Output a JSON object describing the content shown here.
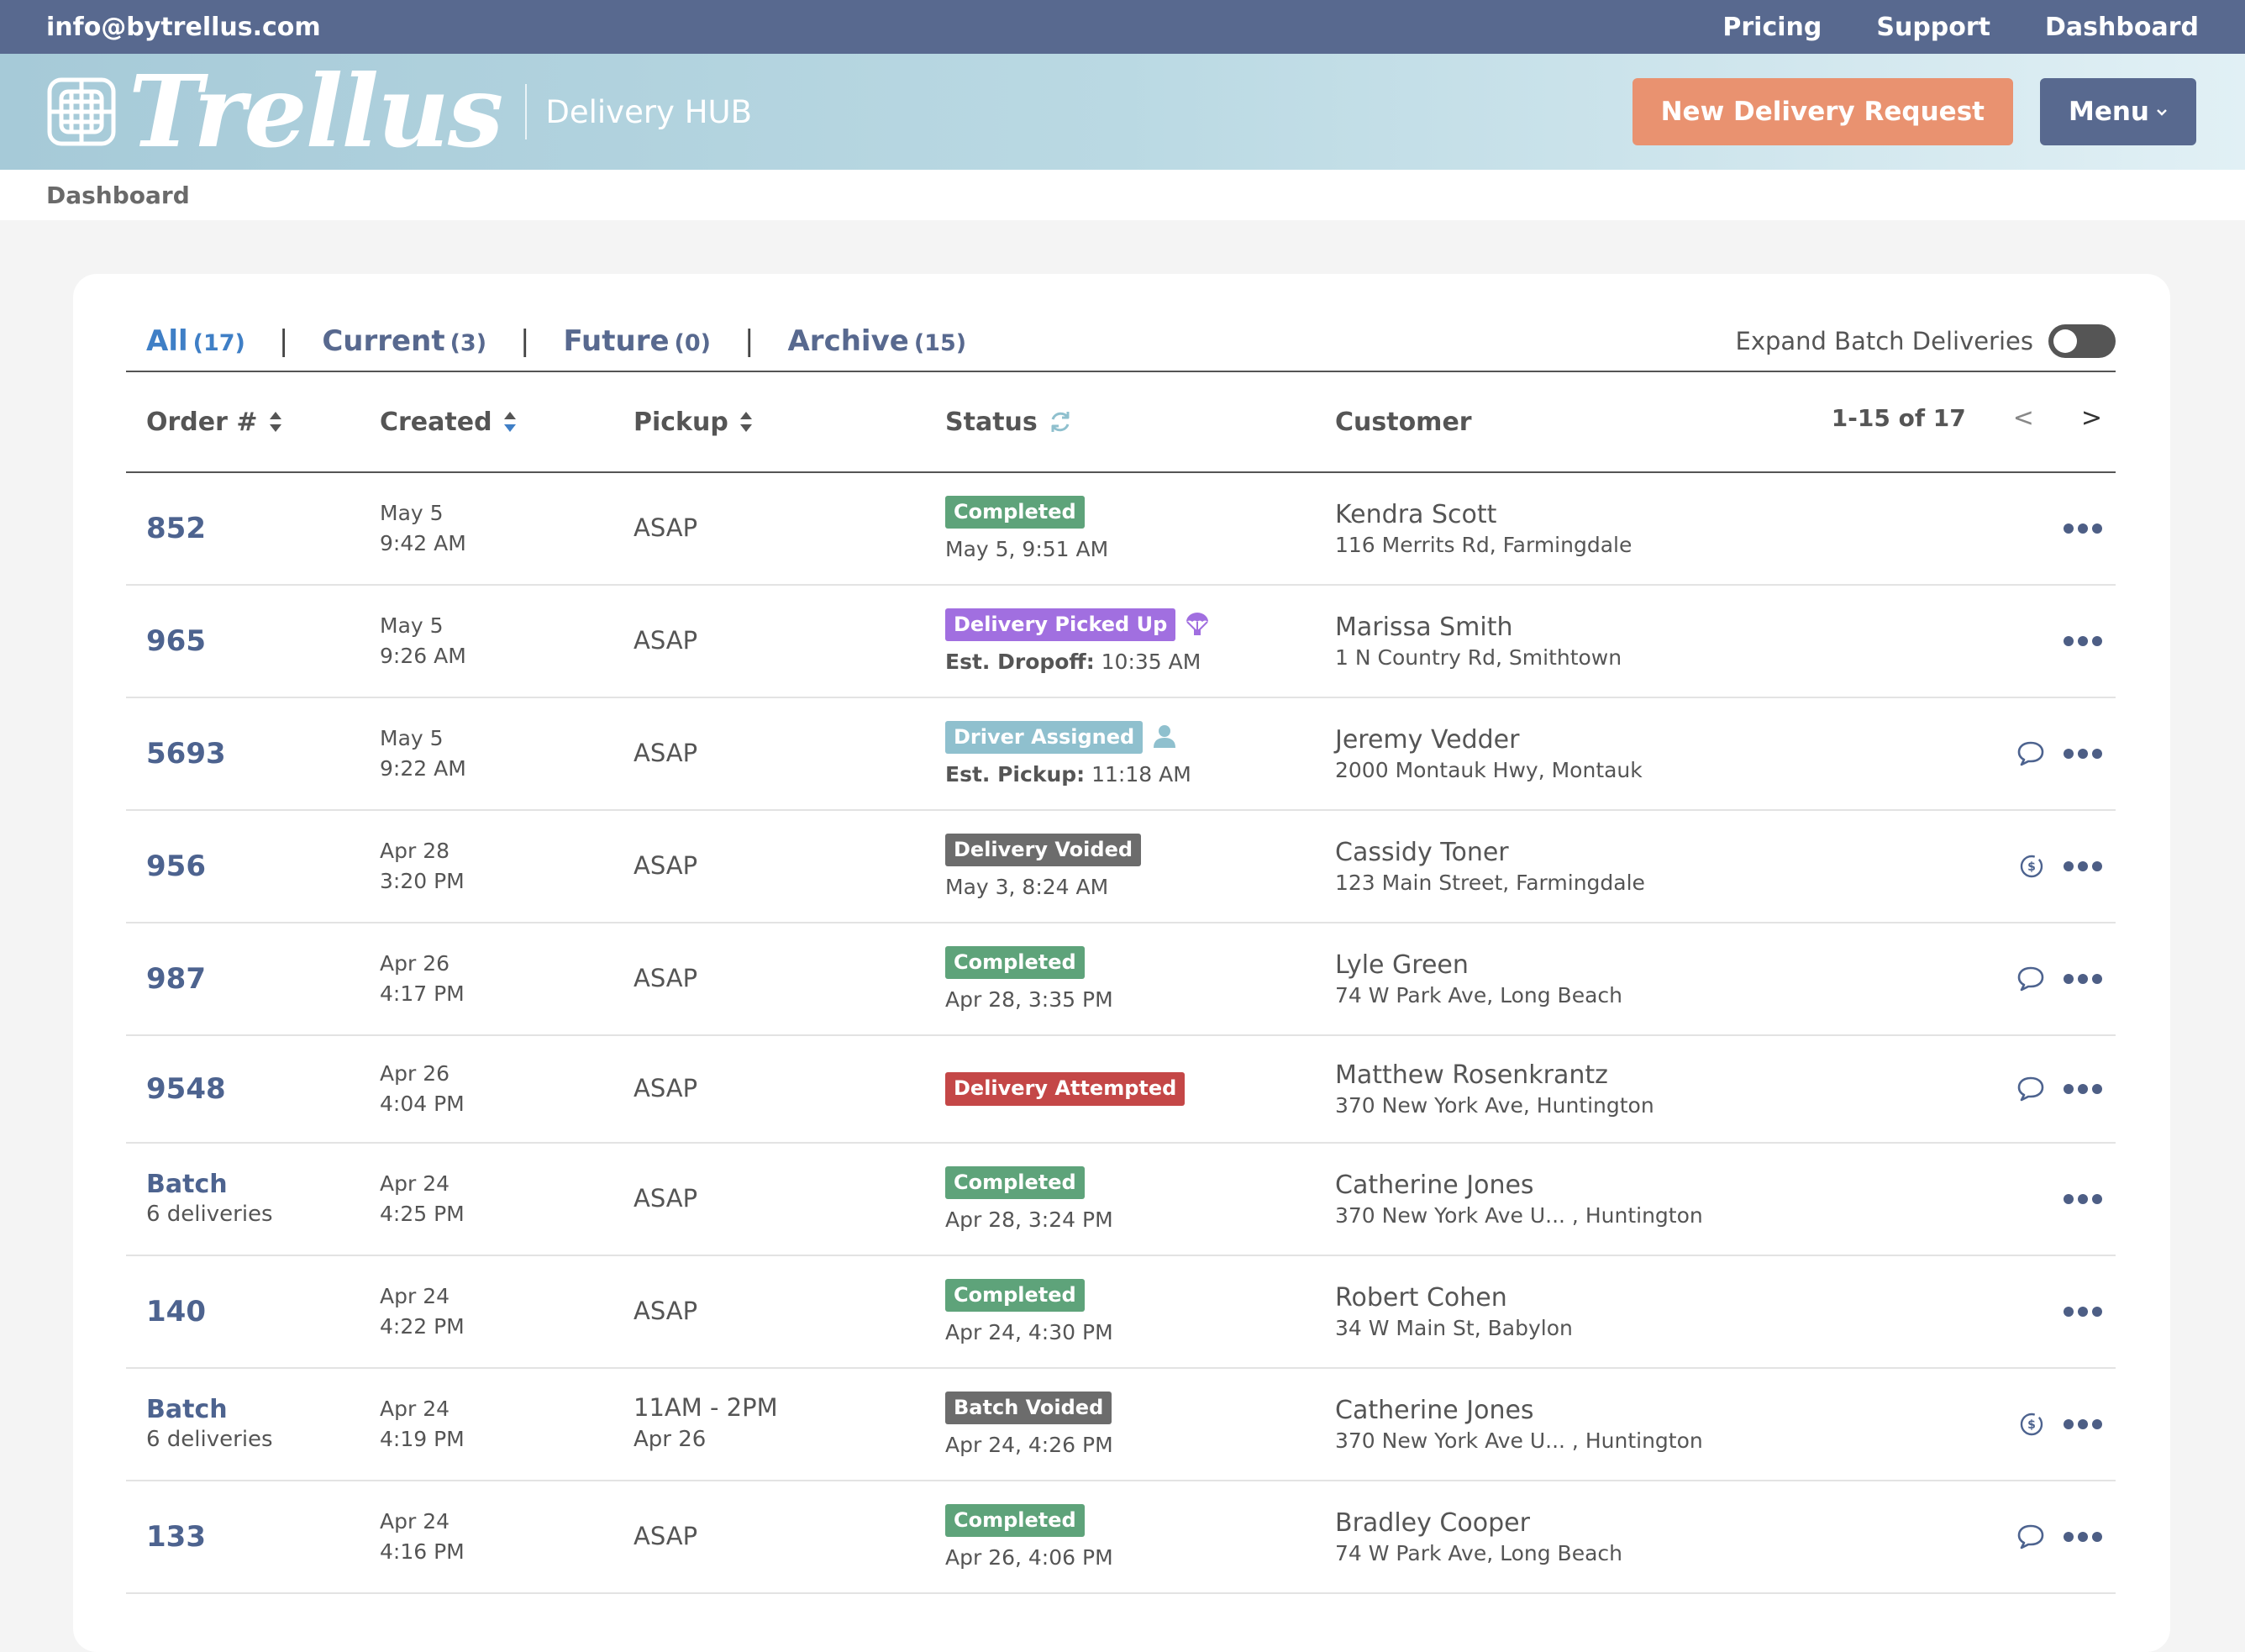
{
  "topbar": {
    "email": "info@bytrellus.com",
    "nav": [
      "Pricing",
      "Support",
      "Dashboard"
    ]
  },
  "header": {
    "brand_name": "Trellus",
    "brand_sub": "Delivery HUB",
    "new_request_label": "New Delivery Request",
    "menu_label": "Menu"
  },
  "breadcrumb": "Dashboard",
  "colors": {
    "topbar": "#58698f",
    "accent_orange": "#e99270",
    "link_blue": "#4d638f",
    "active_tab": "#3f7fc6",
    "completed": "#5ea37a",
    "picked_up": "#a16fe0",
    "driver_assigned": "#8fc0ce",
    "voided": "#6c6c6c",
    "attempted": "#c44747"
  },
  "tabs": [
    {
      "label": "All",
      "count": "(17)"
    },
    {
      "label": "Current",
      "count": "(3)"
    },
    {
      "label": "Future",
      "count": "(0)"
    },
    {
      "label": "Archive",
      "count": "(15)"
    }
  ],
  "expand_label": "Expand Batch Deliveries",
  "columns": {
    "order": "Order #",
    "created": "Created",
    "pickup": "Pickup",
    "status": "Status",
    "customer": "Customer"
  },
  "pager": {
    "range": "1-15 of 17",
    "prev": "<",
    "next": ">"
  },
  "rows": [
    {
      "order": "852",
      "created_date": "May 5",
      "created_time": "9:42 AM",
      "pickup": "ASAP",
      "status": "Completed",
      "status_sub": "May 5, 9:51 AM",
      "customer": "Kendra Scott",
      "address": "116 Merrits Rd, Farmingdale"
    },
    {
      "order": "965",
      "created_date": "May 5",
      "created_time": "9:26 AM",
      "pickup": "ASAP",
      "status": "Delivery Picked Up",
      "status_sub_label": "Est. Dropoff:",
      "status_sub": "10:35 AM",
      "customer": "Marissa Smith",
      "address": "1 N Country Rd, Smithtown"
    },
    {
      "order": "5693",
      "created_date": "May 5",
      "created_time": "9:22 AM",
      "pickup": "ASAP",
      "status": "Driver Assigned",
      "status_sub_label": "Est. Pickup:",
      "status_sub": "11:18 AM",
      "customer": "Jeremy Vedder",
      "address": "2000 Montauk Hwy, Montauk"
    },
    {
      "order": "956",
      "created_date": "Apr 28",
      "created_time": "3:20 PM",
      "pickup": "ASAP",
      "status": "Delivery Voided",
      "status_sub": "May 3, 8:24 AM",
      "customer": "Cassidy Toner",
      "address": "123 Main Street, Farmingdale"
    },
    {
      "order": "987",
      "created_date": "Apr 26",
      "created_time": "4:17 PM",
      "pickup": "ASAP",
      "status": "Completed",
      "status_sub": "Apr 28, 3:35 PM",
      "customer": "Lyle Green",
      "address": "74 W Park Ave, Long Beach"
    },
    {
      "order": "9548",
      "created_date": "Apr 26",
      "created_time": "4:04 PM",
      "pickup": "ASAP",
      "status": "Delivery Attempted",
      "customer": "Matthew Rosenkrantz",
      "address": "370 New York Ave, Huntington"
    },
    {
      "order": "Batch",
      "order_sub": "6 deliveries",
      "created_date": "Apr 24",
      "created_time": "4:25 PM",
      "pickup": "ASAP",
      "status": "Completed",
      "status_sub": "Apr 28, 3:24 PM",
      "customer": "Catherine Jones",
      "address": "370 New York Ave U... , Huntington"
    },
    {
      "order": "140",
      "created_date": "Apr 24",
      "created_time": "4:22 PM",
      "pickup": "ASAP",
      "status": "Completed",
      "status_sub": "Apr 24, 4:30 PM",
      "customer": "Robert Cohen",
      "address": "34 W Main St, Babylon"
    },
    {
      "order": "Batch",
      "order_sub": "6 deliveries",
      "created_date": "Apr 24",
      "created_time": "4:19 PM",
      "pickup": "11AM - 2PM",
      "pickup_sub": "Apr 26",
      "status": "Batch Voided",
      "status_sub": "Apr 24, 4:26 PM",
      "customer": "Catherine Jones",
      "address": "370 New York Ave U... , Huntington"
    },
    {
      "order": "133",
      "created_date": "Apr 24",
      "created_time": "4:16 PM",
      "pickup": "ASAP",
      "status": "Completed",
      "status_sub": "Apr 26, 4:06 PM",
      "customer": "Bradley Cooper",
      "address": "74 W Park Ave, Long Beach"
    }
  ],
  "icons": {
    "logo": "trellus-lattice-icon",
    "sort": "sort-icon",
    "refresh": "refresh-icon",
    "chat": "chat-icon",
    "refund": "refund-icon",
    "more": "more-icon",
    "parachute": "parachute-icon",
    "driver": "driver-icon"
  }
}
